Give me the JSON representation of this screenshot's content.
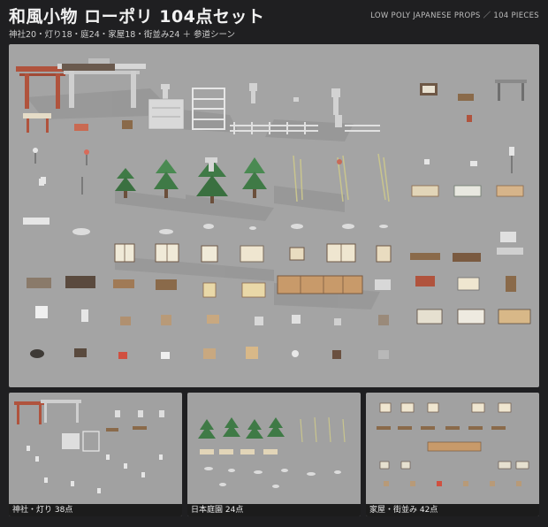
{
  "header": {
    "title": "和風小物 ローポリ 104点セット",
    "subtitle": "神社20・灯り18・庭24・家屋18・街並み24 ＋ 参道シーン",
    "english": "LOW POLY JAPANESE PROPS ／ 104 PIECES"
  },
  "thumbnails": [
    {
      "caption": "神社・灯り 38点"
    },
    {
      "caption": "日本庭園 24点"
    },
    {
      "caption": "家屋・街並み 42点"
    }
  ],
  "colors": {
    "background": "#1f1f21",
    "canvas": "#a4a4a4",
    "torii": "#b0533d",
    "wood": "#8a6a4a",
    "paper": "#efe6d0",
    "foliage": "#3f7a46",
    "stone": "#cfcfcf"
  }
}
